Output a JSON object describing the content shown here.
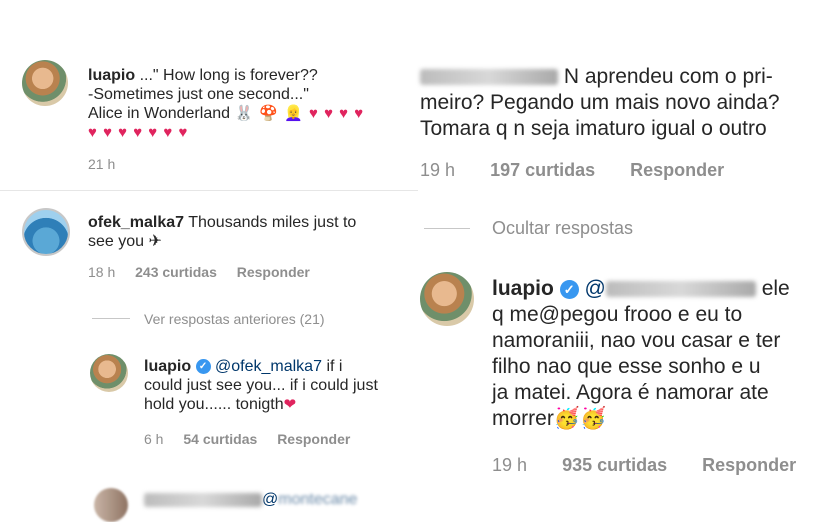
{
  "c1": {
    "username": "luapio",
    "text_line1": "...\" How long is forever??",
    "text_line2": "-Sometimes just one second...\"",
    "text_line3": "Alice in Wonderland",
    "emoji_line3": "🐰 🍄 👱‍♀️ ♥ ♥ ♥ ♥",
    "emoji_line4": "♥ ♥ ♥ ♥ ♥ ♥ ♥",
    "time": "21 h"
  },
  "c2": {
    "username": "ofek_malka7",
    "text_line1": "Thousands miles just to",
    "text_line2": "see you ✈",
    "time": "18 h",
    "likes": "243 curtidas",
    "reply": "Responder"
  },
  "view_prev": "Ver respostas anteriores (21)",
  "c3": {
    "username": "luapio",
    "mention": "@ofek_malka7",
    "text_line1": "if i",
    "text_line2": "could just see you... if i could just",
    "text_line3": "hold you...... tonigth",
    "heart": "❤",
    "time": "6 h",
    "likes": "54 curtidas",
    "reply": "Responder"
  },
  "c4": {
    "mention_at": "@",
    "mention_visible": "montecane"
  },
  "r1": {
    "text_line1": "N aprendeu com o pri-",
    "text_line2": "meiro? Pegando um mais novo ainda?",
    "text_line3": "Tomara q n seja imaturo igual o outro",
    "time": "19 h",
    "likes": "197 curtidas",
    "reply": "Responder"
  },
  "hide_replies": "Ocultar respostas",
  "r2": {
    "username": "luapio",
    "mention_at": "@",
    "text_line1_end": "ele",
    "text_line2": "q me@pegou frooo e eu to",
    "text_line3": "namoraniii, nao vou casar e ter",
    "text_line4": "filho nao que esse sonho e u",
    "text_line5": "ja matei. Agora é namorar ate",
    "text_line6": "morrer🥳🥳",
    "time": "19 h",
    "likes": "935 curtidas",
    "reply": "Responder"
  },
  "colors": {
    "verified": "#3897f0",
    "heart": "#e0245e",
    "meta": "#8e8e8e"
  }
}
